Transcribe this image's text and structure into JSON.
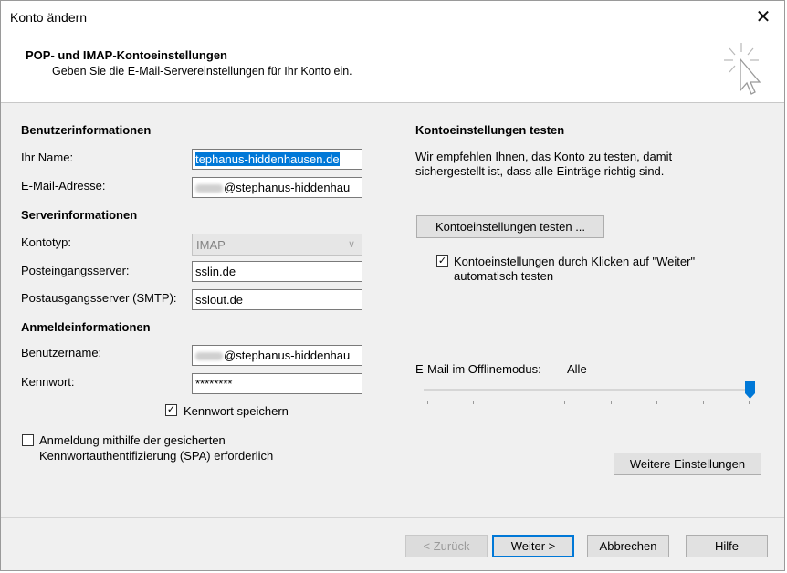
{
  "window": {
    "title": "Konto ändern",
    "close_glyph": "✕"
  },
  "header": {
    "title": "POP- und IMAP-Kontoeinstellungen",
    "subtitle": "Geben Sie die E-Mail-Servereinstellungen für Ihr Konto ein.",
    "icon": "wizard-cursor-icon"
  },
  "user_info": {
    "heading": "Benutzerinformationen",
    "name_label": "Ihr Name:",
    "name_value": "tephanus-hiddenhausen.de",
    "email_label": "E-Mail-Adresse:",
    "email_value": "@stephanus-hiddenhau"
  },
  "server_info": {
    "heading": "Serverinformationen",
    "account_type_label": "Kontotyp:",
    "account_type_value": "IMAP",
    "incoming_label": "Posteingangsserver:",
    "incoming_value": "sslin.de",
    "outgoing_label": "Postausgangsserver (SMTP):",
    "outgoing_value": "sslout.de"
  },
  "login_info": {
    "heading": "Anmeldeinformationen",
    "username_label": "Benutzername:",
    "username_value": "@stephanus-hiddenhau",
    "password_label": "Kennwort:",
    "password_value": "********",
    "remember_label": "Kennwort speichern",
    "remember_checked": true,
    "spa_label_line1": "Anmeldung mithilfe der gesicherten",
    "spa_label_line2": "Kennwortauthentifizierung (SPA) erforderlich",
    "spa_checked": false
  },
  "test": {
    "heading": "Kontoeinstellungen testen",
    "desc_line1": "Wir empfehlen Ihnen, das Konto zu testen, damit",
    "desc_line2": "sichergestellt ist, dass alle Einträge richtig sind.",
    "test_button": "Kontoeinstellungen testen ...",
    "auto_test_line1": "Kontoeinstellungen durch Klicken auf \"Weiter\"",
    "auto_test_line2": "automatisch testen",
    "auto_test_checked": true
  },
  "offline": {
    "label": "E-Mail im Offlinemodus:",
    "value": "Alle",
    "slider_position": 1.0
  },
  "more_settings_button": "Weitere Einstellungen",
  "footer": {
    "back": "< Zurück",
    "next": "Weiter >",
    "cancel": "Abbrechen",
    "help": "Hilfe"
  },
  "colors": {
    "selection": "#0078d7",
    "accent": "#0078d7"
  }
}
